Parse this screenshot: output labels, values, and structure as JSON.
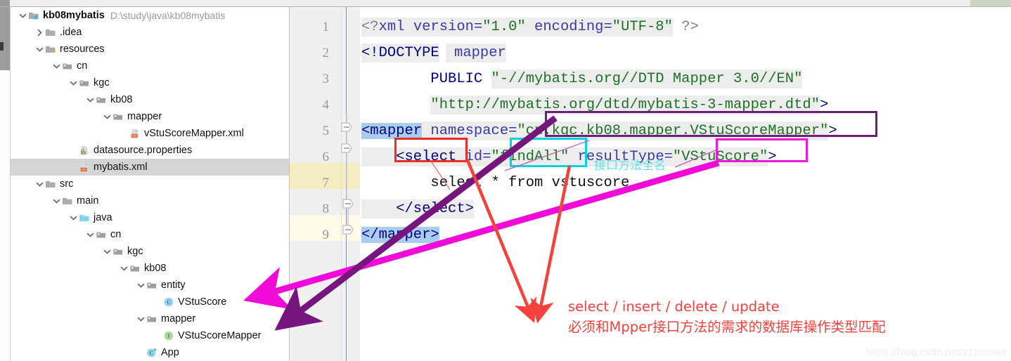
{
  "window": {
    "title": "kb08mybatis",
    "watermark": "https://blog.csdn.net/zzzinsser"
  },
  "tree": {
    "rows": [
      {
        "label": "kb08mybatis",
        "path": "D:\\study\\java\\kb08mybatis",
        "depth": 0,
        "arrow": "down",
        "icon": "module-folder-icon",
        "bold": true,
        "selected": false
      },
      {
        "label": ".idea",
        "path": "",
        "depth": 1,
        "arrow": "right",
        "icon": "folder-icon",
        "bold": false,
        "selected": false
      },
      {
        "label": "resources",
        "path": "",
        "depth": 1,
        "arrow": "down",
        "icon": "resources-folder-icon",
        "bold": false,
        "selected": false
      },
      {
        "label": "cn",
        "path": "",
        "depth": 2,
        "arrow": "down",
        "icon": "package-icon",
        "bold": false,
        "selected": false
      },
      {
        "label": "kgc",
        "path": "",
        "depth": 3,
        "arrow": "down",
        "icon": "package-icon",
        "bold": false,
        "selected": false
      },
      {
        "label": "kb08",
        "path": "",
        "depth": 4,
        "arrow": "down",
        "icon": "package-icon",
        "bold": false,
        "selected": false
      },
      {
        "label": "mapper",
        "path": "",
        "depth": 5,
        "arrow": "down",
        "icon": "package-icon",
        "bold": false,
        "selected": false
      },
      {
        "label": "vStuScoreMapper.xml",
        "path": "",
        "depth": 6,
        "arrow": "none",
        "icon": "xml-file-icon",
        "bold": false,
        "selected": false
      },
      {
        "label": "datasource.properties",
        "path": "",
        "depth": 3,
        "arrow": "none",
        "icon": "properties-file-icon",
        "bold": false,
        "selected": false
      },
      {
        "label": "mybatis.xml",
        "path": "",
        "depth": 3,
        "arrow": "none",
        "icon": "xml-file-icon",
        "bold": false,
        "selected": true
      },
      {
        "label": "src",
        "path": "",
        "depth": 1,
        "arrow": "down",
        "icon": "folder-icon",
        "bold": false,
        "selected": false
      },
      {
        "label": "main",
        "path": "",
        "depth": 2,
        "arrow": "down",
        "icon": "folder-icon",
        "bold": false,
        "selected": false
      },
      {
        "label": "java",
        "path": "",
        "depth": 3,
        "arrow": "down",
        "icon": "source-folder-icon",
        "bold": false,
        "selected": false
      },
      {
        "label": "cn",
        "path": "",
        "depth": 4,
        "arrow": "down",
        "icon": "package-icon",
        "bold": false,
        "selected": false
      },
      {
        "label": "kgc",
        "path": "",
        "depth": 5,
        "arrow": "down",
        "icon": "package-icon",
        "bold": false,
        "selected": false
      },
      {
        "label": "kb08",
        "path": "",
        "depth": 6,
        "arrow": "down",
        "icon": "package-icon",
        "bold": false,
        "selected": false
      },
      {
        "label": "entity",
        "path": "",
        "depth": 7,
        "arrow": "down",
        "icon": "package-icon",
        "bold": false,
        "selected": false
      },
      {
        "label": "VStuScore",
        "path": "",
        "depth": 8,
        "arrow": "none",
        "icon": "class-icon",
        "bold": false,
        "selected": false
      },
      {
        "label": "mapper",
        "path": "",
        "depth": 7,
        "arrow": "down",
        "icon": "package-icon",
        "bold": false,
        "selected": false
      },
      {
        "label": "VStuScoreMapper",
        "path": "",
        "depth": 8,
        "arrow": "none",
        "icon": "interface-icon",
        "bold": false,
        "selected": false
      },
      {
        "label": "App",
        "path": "",
        "depth": 7,
        "arrow": "none",
        "icon": "runnable-class-icon",
        "bold": false,
        "selected": false
      }
    ]
  },
  "editor": {
    "line_numbers": [
      "1",
      "2",
      "3",
      "4",
      "5",
      "6",
      "7",
      "8",
      "9"
    ],
    "lines": {
      "l1_a": "<?",
      "l1_b": "xml version=",
      "l1_c": "\"1.0\"",
      "l1_d": " encoding=",
      "l1_e": "\"UTF-8\"",
      "l1_f": " ?>",
      "l2_a": "<!DOCTYPE",
      "l2_b": " mapper",
      "l3_a": "        PUBLIC ",
      "l3_b": "\"-//mybatis.org//DTD Mapper 3.0//EN\"",
      "l4_a": "        ",
      "l4_b": "\"http://mybatis.org/dtd/mybatis-3-mapper.dtd\"",
      "l4_c": ">",
      "l5_a": "<mapper",
      "l5_b": " namespace=",
      "l5_c": "\"",
      "l5_d": "cn.kgc.kb08.mapper.VStuScoreMapper",
      "l5_e": "\"",
      "l5_f": ">",
      "l6_a": "    <select",
      "l6_b": " id=",
      "l6_c": "\"",
      "l6_d": "findAll",
      "l6_e": "\"",
      "l6_f": " resultType=",
      "l6_g": "\"",
      "l6_h": "VStuScore",
      "l6_i": "\"",
      "l6_j": ">",
      "l7": "        select * from vstuscore",
      "l8": "    </select>",
      "l9": "</mapper>"
    }
  },
  "annotations": {
    "cyan_note": "接口方法全名",
    "red_line1": "select / insert / delete / update",
    "red_line2": "必须和Mpper接口方法的需求的数据库操作类型匹配"
  },
  "colors": {
    "purple_box": "#6b2177",
    "red_box": "#ef2d28",
    "cyan_box": "#00d5de",
    "magenta_box": "#ea19d8",
    "magenta_arrow": "#f20ad8",
    "purple_arrow": "#76157e",
    "red_arrow": "#f4433c",
    "selection_blue": "#a8cdf0",
    "highlight_line": "#f5ecc2"
  }
}
